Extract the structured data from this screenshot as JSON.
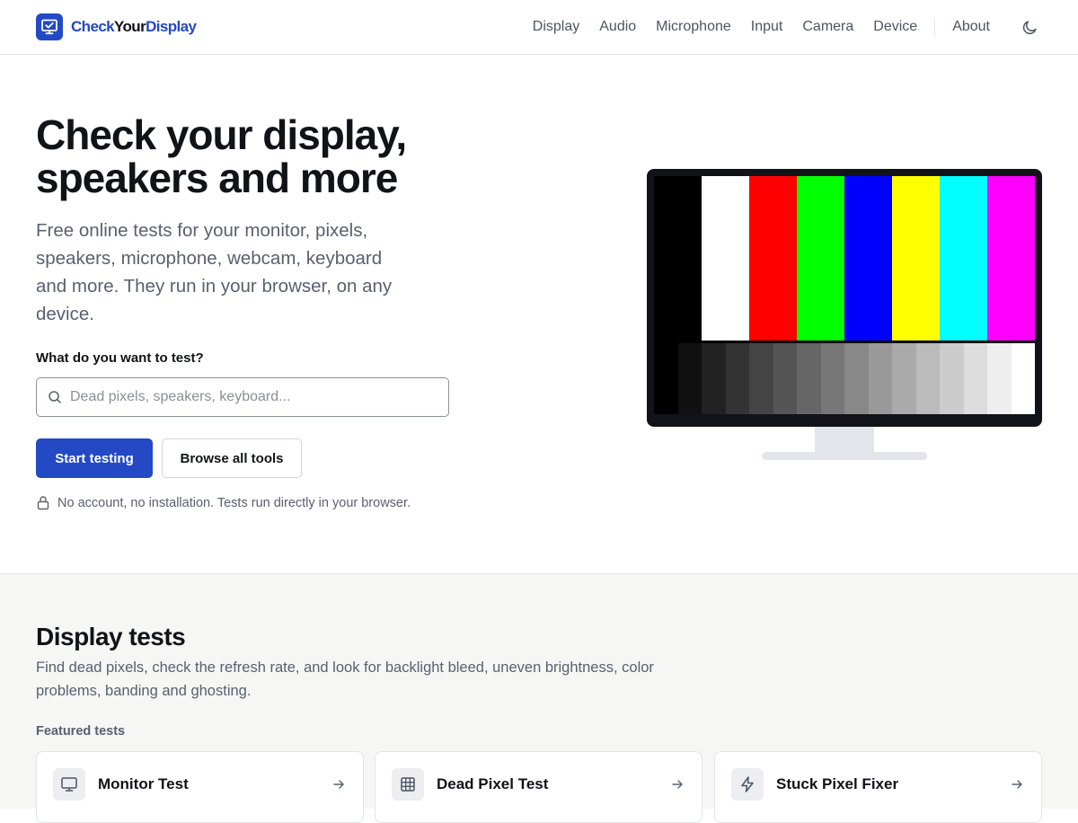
{
  "brand": {
    "part1": "Check",
    "part2": "Your",
    "part3": "Display"
  },
  "nav": {
    "items": [
      {
        "label": "Display"
      },
      {
        "label": "Audio"
      },
      {
        "label": "Microphone"
      },
      {
        "label": "Input"
      },
      {
        "label": "Camera"
      },
      {
        "label": "Device"
      }
    ],
    "about": "About",
    "theme_icon": "moon-icon"
  },
  "hero": {
    "title": "Check your display, speakers and more",
    "subtitle": "Free online tests for your monitor, pixels, speakers, microphone, webcam, keyboard and more. They run in your browser, on any device.",
    "search_label": "What do you want to test?",
    "search_placeholder": "Dead pixels, speakers, keyboard...",
    "search_value": "",
    "primary_button": "Start testing",
    "secondary_button": "Browse all tools",
    "note": "No account, no installation. Tests run directly in your browser."
  },
  "test_pattern": {
    "color_bars": [
      "#000000",
      "#ffffff",
      "#ff0000",
      "#00ff00",
      "#0000ff",
      "#ffff00",
      "#00ffff",
      "#ff00ff"
    ],
    "gray_steps": [
      "#000000",
      "#111111",
      "#222222",
      "#333333",
      "#444444",
      "#555555",
      "#666666",
      "#777777",
      "#888888",
      "#999999",
      "#aaaaaa",
      "#bbbbbb",
      "#cccccc",
      "#dddddd",
      "#eeeeee",
      "#ffffff"
    ]
  },
  "display_section": {
    "title": "Display tests",
    "description": "Find dead pixels, check the refresh rate, and look for backlight bleed, uneven brightness, color problems, banding and ghosting.",
    "featured_label": "Featured tests",
    "cards": [
      {
        "name": "Monitor Test",
        "icon": "monitor-icon"
      },
      {
        "name": "Dead Pixel Test",
        "icon": "grid-icon"
      },
      {
        "name": "Stuck Pixel Fixer",
        "icon": "lightning-icon"
      }
    ]
  },
  "colors": {
    "accent": "#2349c5",
    "text": "#111318",
    "muted": "#596070",
    "section_bg": "#f6f6f4"
  }
}
